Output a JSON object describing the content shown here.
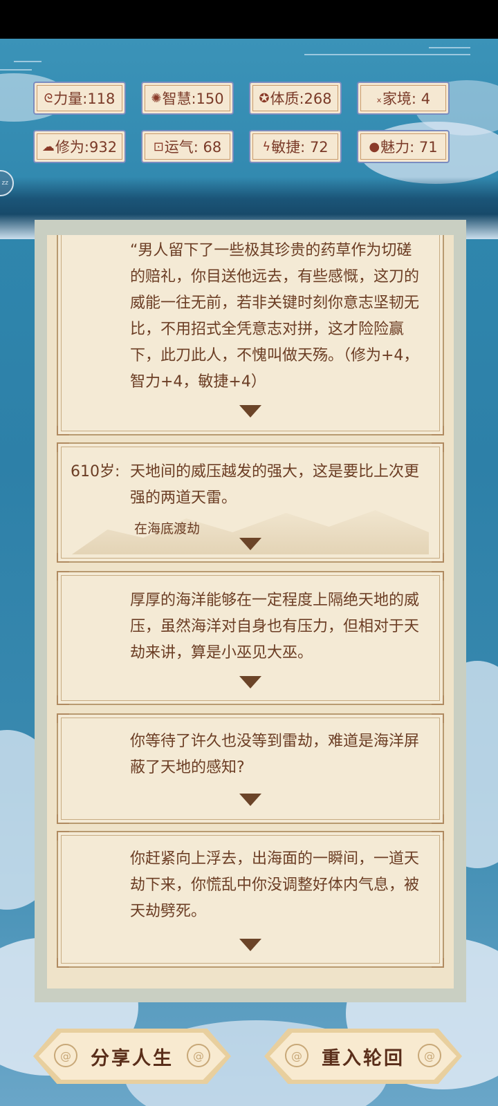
{
  "stats": [
    {
      "icon": "arm-icon",
      "glyph": "ᘓ",
      "label": "力量:118"
    },
    {
      "icon": "bulb-icon",
      "glyph": "✺",
      "label": "智慧:150"
    },
    {
      "icon": "cross-icon",
      "glyph": "✪",
      "label": "体质:268"
    },
    {
      "icon": "money-bag-icon",
      "glyph": "ₓ",
      "label": "家境:  4"
    },
    {
      "icon": "cloud-icon",
      "glyph": "☁",
      "label": "修为:932"
    },
    {
      "icon": "luck-icon",
      "glyph": "⊡",
      "label": "运气: 68"
    },
    {
      "icon": "lightning-icon",
      "glyph": "ϟ",
      "label": "敏捷: 72"
    },
    {
      "icon": "charm-icon",
      "glyph": "●",
      "label": "魅力: 71"
    }
  ],
  "events": [
    {
      "age": "",
      "text": "“男人留下了一些极其珍贵的药草作为切磋的赔礼，你目送他远去，有些感慨，这刀的威能一往无前，若非关键时刻你意志坚韧无比，不用招式全凭意志对拼，这才险险赢下，此刀此人，不愧叫做天殇。（修为+4，智力+4，敏捷+4）",
      "sub": ""
    },
    {
      "age": "610岁:",
      "text": "天地间的威压越发的强大，这是要比上次更强的两道天雷。",
      "sub": "在海底渡劫"
    },
    {
      "age": "",
      "text": "厚厚的海洋能够在一定程度上隔绝天地的威压，虽然海洋对自身也有压力，但相对于天劫来讲，算是小巫见大巫。",
      "sub": ""
    },
    {
      "age": "",
      "text": "你等待了许久也没等到雷劫，难道是海洋屏蔽了天地的感知?",
      "sub": ""
    },
    {
      "age": "",
      "text": "你赶紧向上浮去，出海面的一瞬间，一道天劫下来，你慌乱中你没调整好体内气息，被天劫劈死。",
      "sub": ""
    }
  ],
  "buttons": {
    "share": "分享人生",
    "restart": "重入轮回"
  },
  "badge": "zz"
}
